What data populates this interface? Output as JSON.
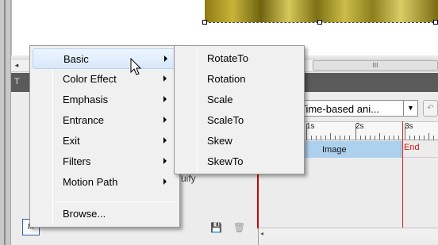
{
  "background": {
    "scrollbar_grip": "III",
    "panel_header_text": "T",
    "timeline_dropdown": "Time-based ani...",
    "dropdown_arrow": "▼",
    "ruler_labels": [
      "1s",
      "2s",
      "3s"
    ],
    "track_label": "Image",
    "end_label": "End",
    "partial_text": "uify",
    "fx_label": "fx"
  },
  "context_menu": {
    "items": [
      {
        "label": "Basic",
        "has_submenu": true,
        "highlighted": true
      },
      {
        "label": "Color Effect",
        "has_submenu": true
      },
      {
        "label": "Emphasis",
        "has_submenu": true
      },
      {
        "label": "Entrance",
        "has_submenu": true
      },
      {
        "label": "Exit",
        "has_submenu": true
      },
      {
        "label": "Filters",
        "has_submenu": true
      },
      {
        "label": "Motion Path",
        "has_submenu": true
      },
      {
        "label": "Browse...",
        "has_submenu": false
      }
    ]
  },
  "submenu": {
    "items": [
      {
        "label": "RotateTo"
      },
      {
        "label": "Rotation"
      },
      {
        "label": "Scale"
      },
      {
        "label": "ScaleTo"
      },
      {
        "label": "Skew"
      },
      {
        "label": "SkewTo"
      }
    ]
  },
  "icons": [
    "mouse-cursor-icon",
    "save-icon",
    "trash-icon",
    "submenu-arrow-icon"
  ],
  "colors": {
    "highlight": "#d7e8fb",
    "track": "#aed0ef",
    "end_marker": "#e02020"
  }
}
